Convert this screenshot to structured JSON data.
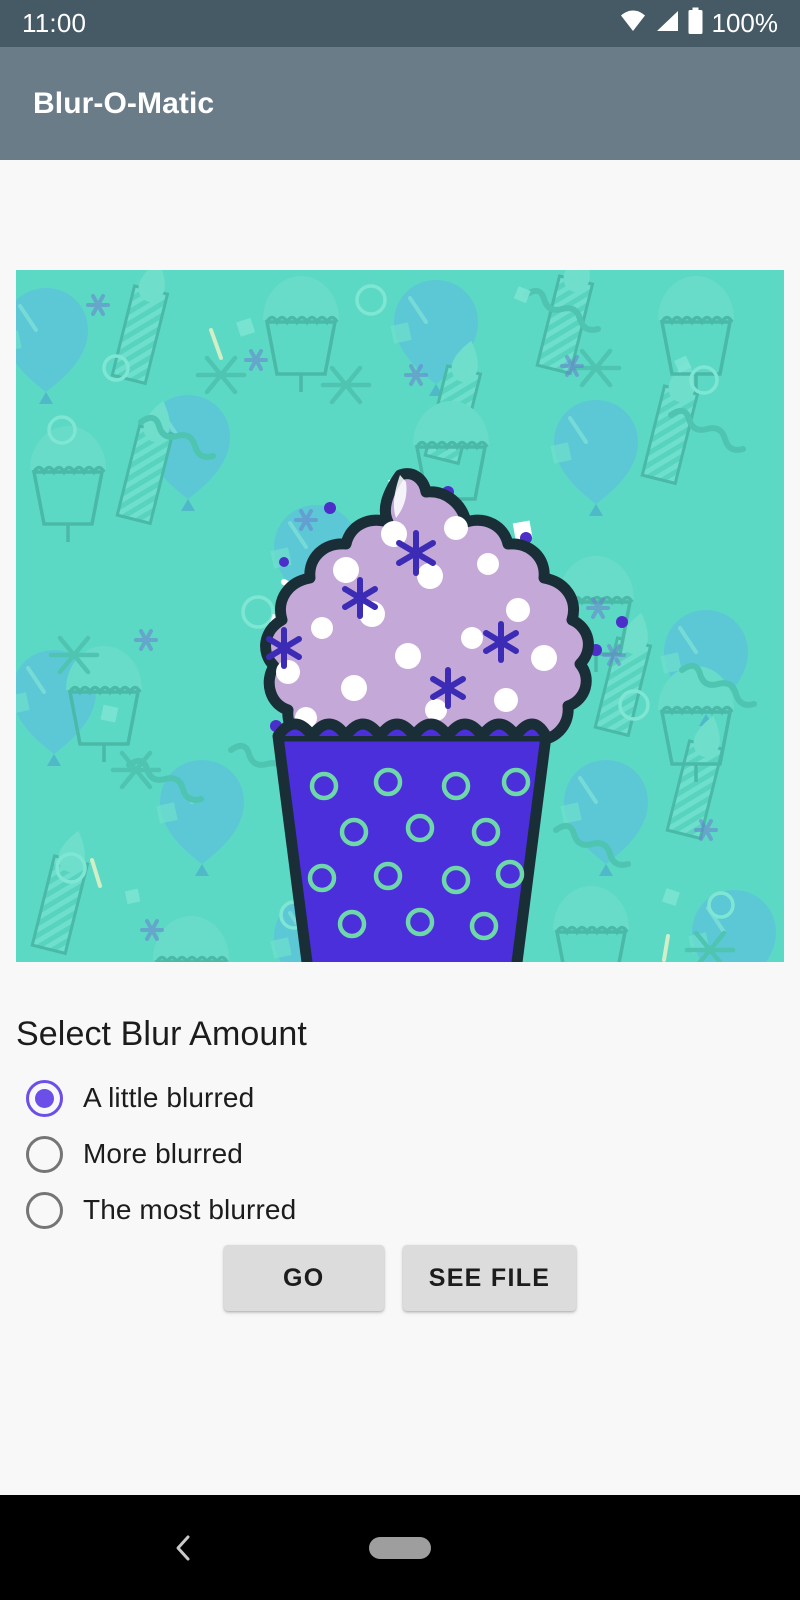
{
  "status_bar": {
    "time": "11:00",
    "battery_percent": "100%",
    "icons": [
      "wifi-icon",
      "cellular-signal-icon",
      "battery-icon"
    ],
    "background_color": "#455A64"
  },
  "app_bar": {
    "title": "Blur-O-Matic",
    "background_color": "#6B7C89",
    "title_color": "#FFFFFF"
  },
  "main": {
    "background_color": "#F8F8F8",
    "image": {
      "name": "cupcake-image",
      "alt": "Purple frosted cupcake on teal birthday pattern background",
      "background_color": "#5BD9C4",
      "pattern_color": "#4FCCB8",
      "frosting_color": "#C4A8D8",
      "wrapper_color": "#4A2FDB",
      "outline_color": "#1A2E38",
      "sprinkle_color": "#FFFFFF",
      "accent_dot_color": "#4B2FC8",
      "balloon_color": "#5BC7D4"
    },
    "blur_section": {
      "title": "Select Blur Amount",
      "selected_index": 0,
      "accent_color": "#6C4FE8",
      "unselected_color": "#757575",
      "options": [
        {
          "label": "A little blurred",
          "selected": true
        },
        {
          "label": "More blurred",
          "selected": false
        },
        {
          "label": "The most blurred",
          "selected": false
        }
      ]
    },
    "buttons": [
      {
        "label": "GO",
        "name": "go-button"
      },
      {
        "label": "SEE FILE",
        "name": "see-file-button"
      }
    ],
    "button_color": "#DCDCDC"
  },
  "nav_bar": {
    "background_color": "#000000",
    "back_icon": "chevron-left-icon",
    "home_indicator": "home-pill-indicator"
  }
}
